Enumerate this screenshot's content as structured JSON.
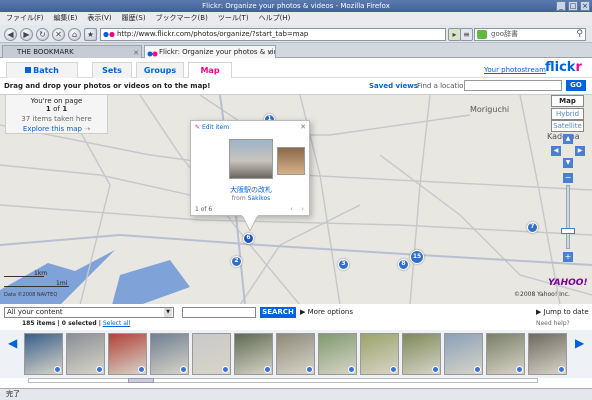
{
  "window": {
    "title": "Flickr: Organize your photos & videos - Mozilla Firefox"
  },
  "menu": [
    "ファイル(F)",
    "編集(E)",
    "表示(V)",
    "履歴(S)",
    "ブックマーク(B)",
    "ツール(T)",
    "ヘルプ(H)"
  ],
  "nav": {
    "url": "http://www.flickr.com/photos/organize/?start_tab=map",
    "search_placeholder": "goo辞書"
  },
  "tabs": [
    {
      "label": "THE BOOKMARK"
    },
    {
      "label": "Flickr: Organize your photos & videos"
    }
  ],
  "flickr": {
    "tabs": [
      "Batch Organize",
      "Sets",
      "Groups",
      "Map"
    ],
    "photostream_link": "Your photostream",
    "logo_a": "flick",
    "logo_b": "r"
  },
  "toolbar": {
    "hint": "Drag and drop your photos or videos on to the map!",
    "saved_views": "Saved views",
    "find_label": "Find a location",
    "go": "GO"
  },
  "infobox": {
    "line1": "You're on page",
    "page": "1",
    "of": "of",
    "total": "1",
    "taken": "37 items taken here",
    "explore": "Explore this map"
  },
  "popup": {
    "edit": "Edit item",
    "caption": "大阪駅の改札",
    "from_label": "from",
    "from_user": "Sakikos",
    "counter": "1 of 6"
  },
  "mapctl": {
    "map": "Map",
    "hybrid": "Hybrid",
    "satellite": "Satellite"
  },
  "mapLabels": {
    "moriguchi": "Moriguchi",
    "kadoma": "Kadoma"
  },
  "scale": {
    "km": "1km",
    "mi": "1mi",
    "data": "Data ©2008 NAVTEQ"
  },
  "yahoo": {
    "logo": "YAHOO!",
    "copyright": "©2008 Yahoo! Inc."
  },
  "markers": [
    "1",
    "2",
    "3",
    "6",
    "15",
    "7",
    "8"
  ],
  "bottom": {
    "content_select": "All your content",
    "search_btn": "SEARCH",
    "more_options": "More options",
    "jump": "Jump to date",
    "count_text": "185 items | 0 selected |",
    "select_all": "Select all",
    "need_help": "Need help?"
  },
  "thumb_colors": [
    "#3a5f8a",
    "#8a8f96",
    "#b0433a",
    "#6f7f92",
    "#c9c9c9",
    "#5d6a52",
    "#8d8a7a",
    "#7f9a6e",
    "#9ba36a",
    "#7d8a5a",
    "#8aa0b8",
    "#7a7f68",
    "#6e6a5f"
  ],
  "status": "完了"
}
